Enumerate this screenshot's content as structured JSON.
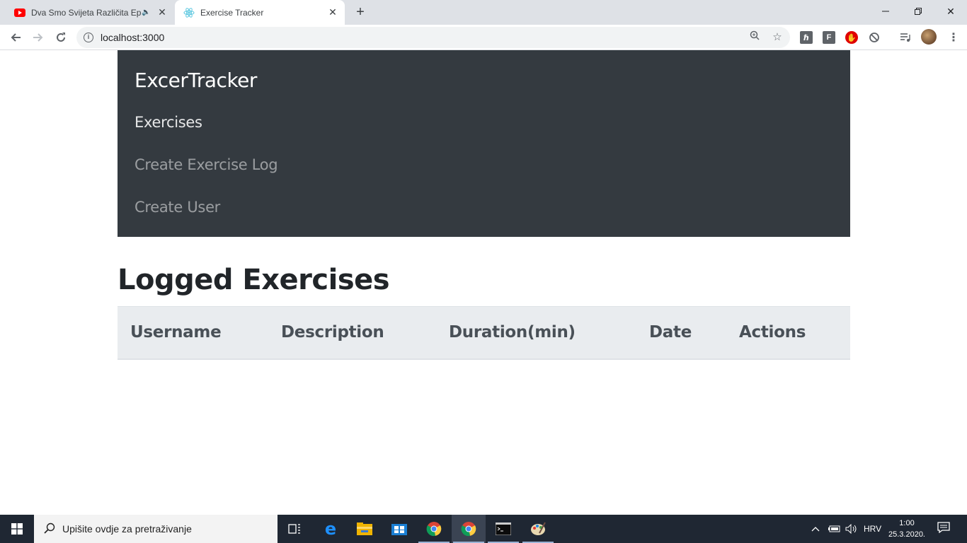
{
  "browser": {
    "tabs": [
      {
        "title": "Dva Smo Svijeta Različita Ep",
        "icon": "youtube-icon",
        "active": false,
        "muted_indicator": "🔈"
      },
      {
        "title": "Exercise Tracker",
        "icon": "react-icon",
        "active": true
      }
    ],
    "url": "localhost:3000",
    "colors": {
      "tabstrip": "#dee1e6",
      "youtube_red": "#ff0000"
    }
  },
  "app": {
    "brand": "ExcerTracker",
    "nav": [
      {
        "label": "Exercises",
        "active": true
      },
      {
        "label": "Create Exercise Log",
        "active": false
      },
      {
        "label": "Create User",
        "active": false
      }
    ],
    "heading": "Logged Exercises",
    "table": {
      "columns": [
        "Username",
        "Description",
        "Duration(min)",
        "Date",
        "Actions"
      ],
      "rows": []
    },
    "colors": {
      "navbar": "#343a40",
      "table_header": "#e9ecef"
    }
  },
  "taskbar": {
    "search_placeholder": "Upišite ovdje za pretraživanje",
    "language": "HRV",
    "time": "1:00",
    "date": "25.3.2020."
  }
}
